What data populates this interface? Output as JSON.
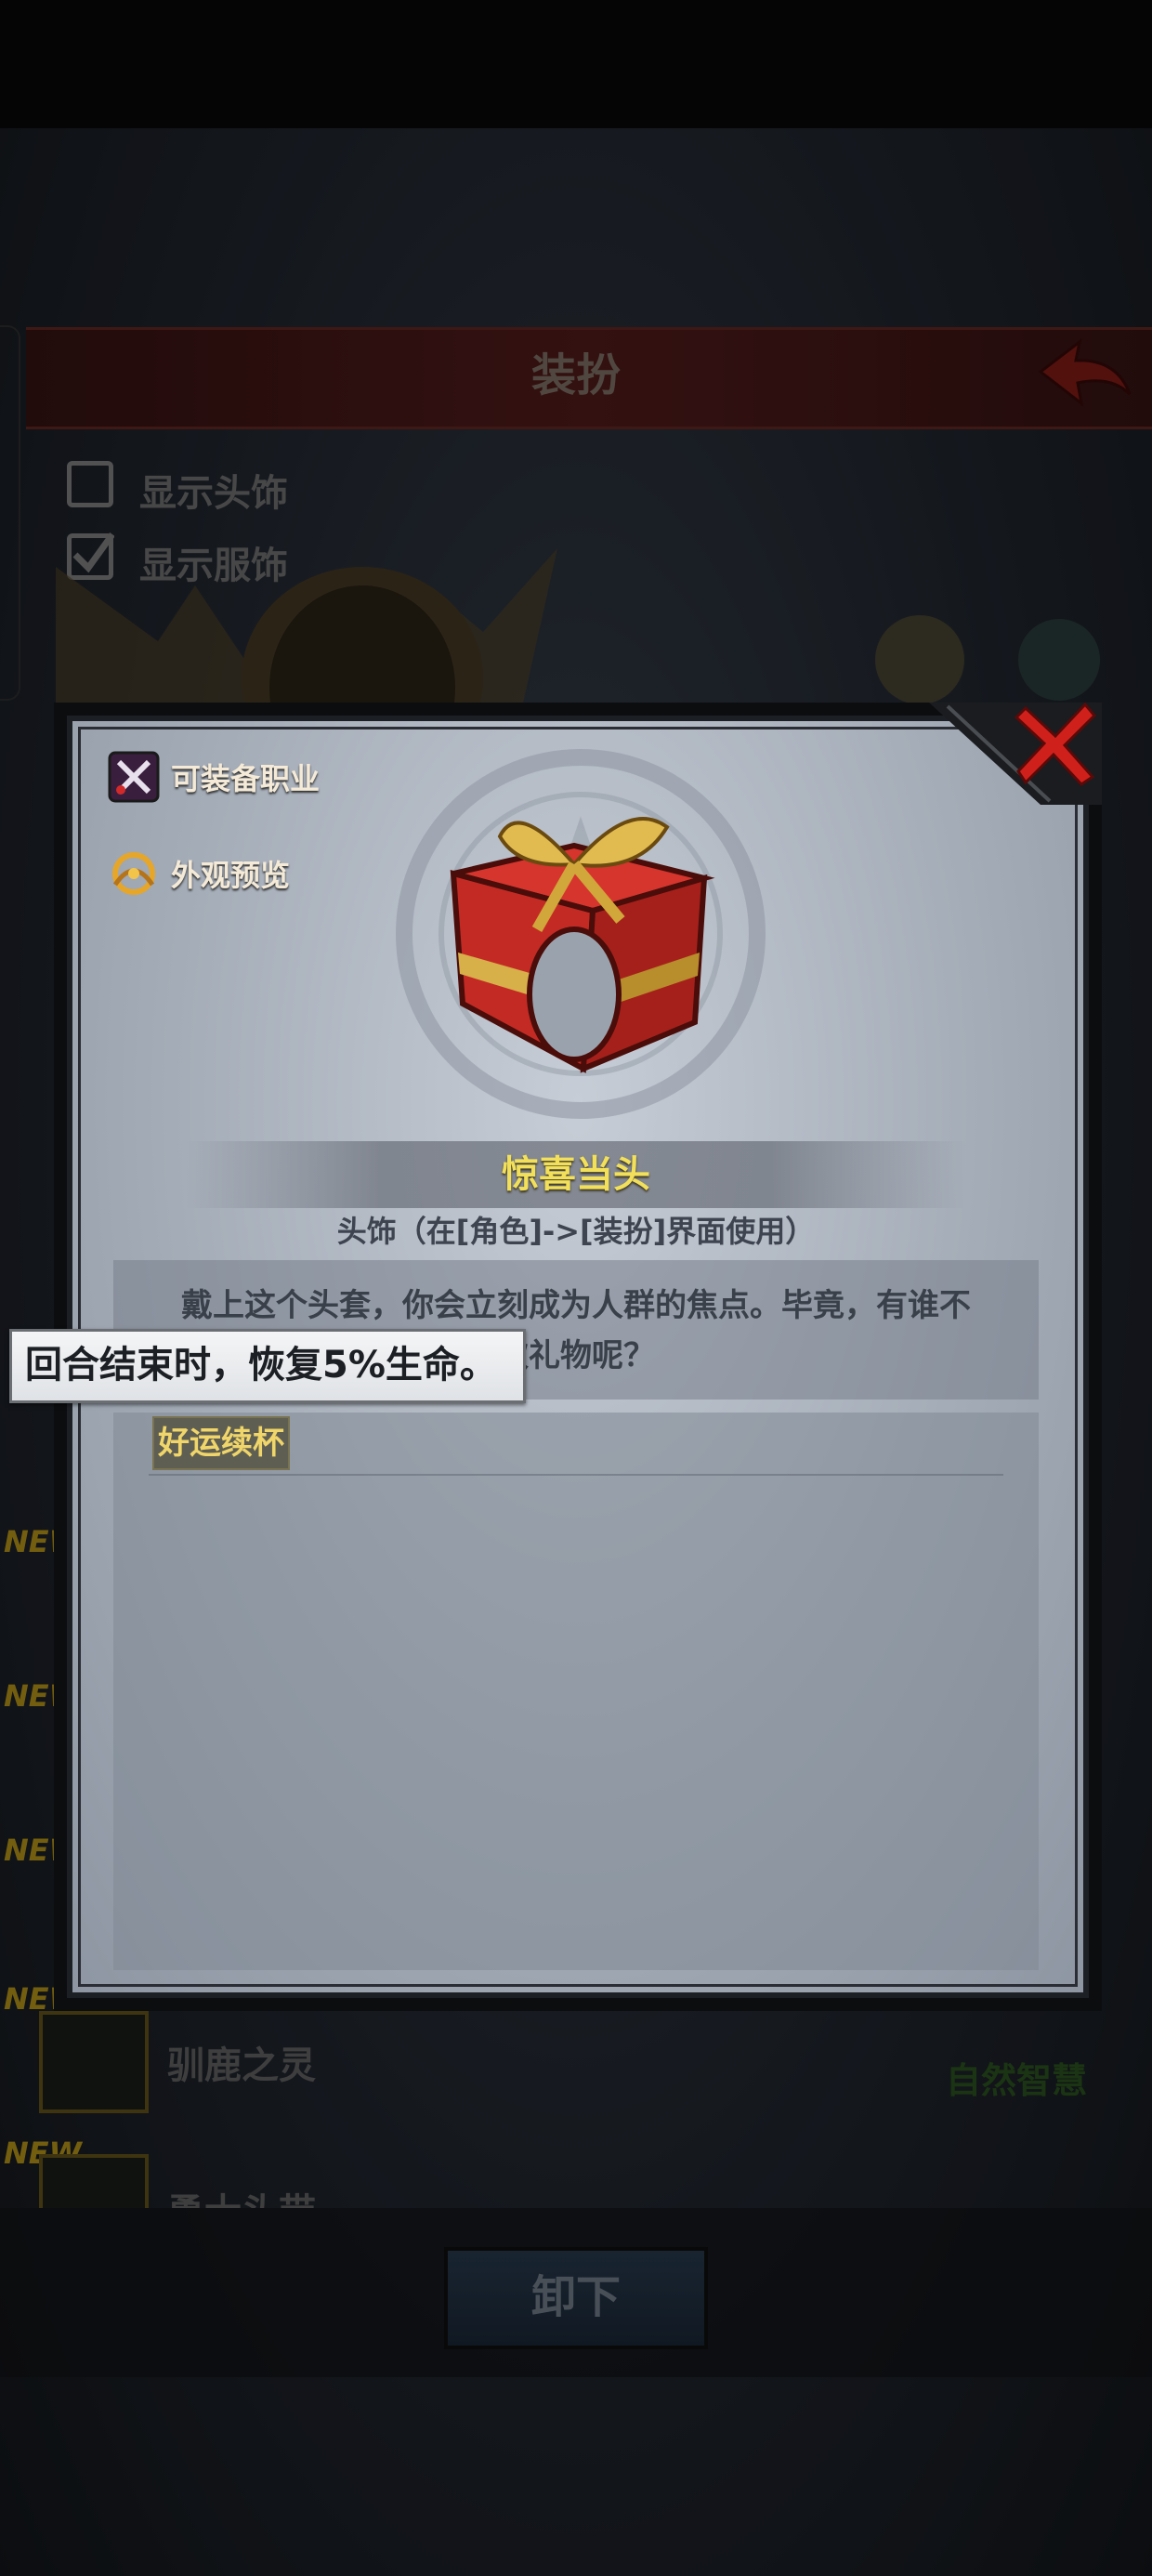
{
  "screen": {
    "title": "装扮",
    "options": [
      {
        "label": "显示头饰",
        "checked": false
      },
      {
        "label": "显示服饰",
        "checked": true
      }
    ],
    "list": {
      "new_tag": "NEW",
      "items": [
        {
          "name": "驯鹿之灵",
          "set": "自然智慧"
        },
        {
          "name": "勇士头带"
        }
      ]
    },
    "unequip_label": "卸下"
  },
  "modal": {
    "equip_class_label": "可装备职业",
    "preview_label": "外观预览",
    "item_name": "惊喜当头",
    "item_type": "头饰（在[角色]->[装扮]界面使用）",
    "description_line1": "戴上这个头套，你会立刻成为人群的焦点。毕竟，有谁不",
    "description_line2": "欢礼物呢？",
    "set_name": "好运续杯",
    "tooltip": "回合结束时，恢复5%生命。"
  },
  "colors": {
    "title_bar": "#5a1e1e",
    "item_name": "#f2e05a",
    "close_red": "#d0201c",
    "new_tag": "#c7a21b"
  },
  "icons": {
    "close": "close-x-icon",
    "back": "back-arrow-icon",
    "equip_class": "crossed-weapons-icon",
    "preview": "preview-swirl-icon",
    "item": "gift-box-headgear"
  }
}
